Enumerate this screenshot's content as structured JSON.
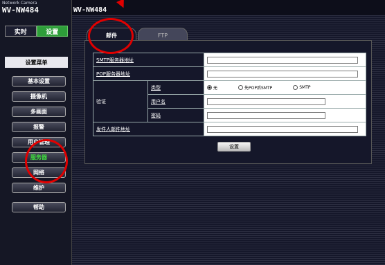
{
  "brand": {
    "subtitle": "Network Camera",
    "model": "WV-NW484"
  },
  "header": {
    "product": "WV-NW484"
  },
  "mode_tabs": {
    "live": "实时",
    "setup": "设置"
  },
  "sidebar": {
    "menu_title": "设置菜单",
    "items": [
      {
        "label": "基本设置"
      },
      {
        "label": "摄像机"
      },
      {
        "label": "多画面"
      },
      {
        "label": "报警"
      },
      {
        "label": "用户管理"
      },
      {
        "label": "服务器"
      },
      {
        "label": "网络"
      },
      {
        "label": "维护"
      },
      {
        "label": "帮助"
      }
    ],
    "active_index": 5
  },
  "tabs": {
    "mail": "邮件",
    "ftp": "FTP"
  },
  "form": {
    "smtp_server_label": "SMTP服务器地址",
    "pop_server_label": "POP服务器地址",
    "auth_label": "验证",
    "auth_type_label": "类型",
    "auth_type_options": [
      "无",
      "先POP后SMTP",
      "SMTP"
    ],
    "auth_type_selected": "无",
    "username_label": "用户名",
    "password_label": "密码",
    "sender_label": "发件人邮件地址"
  },
  "buttons": {
    "set": "设置"
  },
  "colors": {
    "accent_green": "#2e9e3a",
    "annotation_red": "#e00000",
    "active_menu_text": "#3fdc3f"
  }
}
